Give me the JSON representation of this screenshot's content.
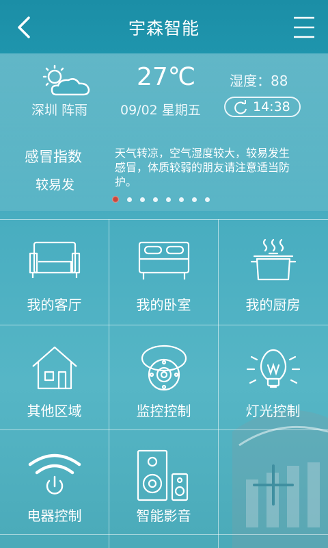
{
  "header": {
    "title": "宇森智能"
  },
  "weather": {
    "city_condition": "深圳 阵雨",
    "temperature": "27℃",
    "date": "09/02 星期五",
    "humidity": "湿度：88",
    "time": "14:38",
    "icon": "partly-cloudy-icon"
  },
  "health": {
    "title": "感冒指数",
    "level": "较易发",
    "description": "天气转凉，空气湿度较大，较易发生感冒，体质较弱的朋友请注意适当防护。",
    "page_count": 8,
    "active_page": 0
  },
  "tiles": [
    {
      "label": "我的客厅",
      "icon": "sofa-icon"
    },
    {
      "label": "我的卧室",
      "icon": "bed-icon"
    },
    {
      "label": "我的厨房",
      "icon": "pot-icon"
    },
    {
      "label": "其他区域",
      "icon": "house-icon"
    },
    {
      "label": "监控控制",
      "icon": "camera-icon"
    },
    {
      "label": "灯光控制",
      "icon": "bulb-icon"
    },
    {
      "label": "电器控制",
      "icon": "wifi-power-icon"
    },
    {
      "label": "智能影音",
      "icon": "speaker-icon"
    },
    {
      "label": "",
      "icon": "plus-icon"
    }
  ],
  "colors": {
    "accent": "#c8463a",
    "header": "#1b8ea6"
  }
}
